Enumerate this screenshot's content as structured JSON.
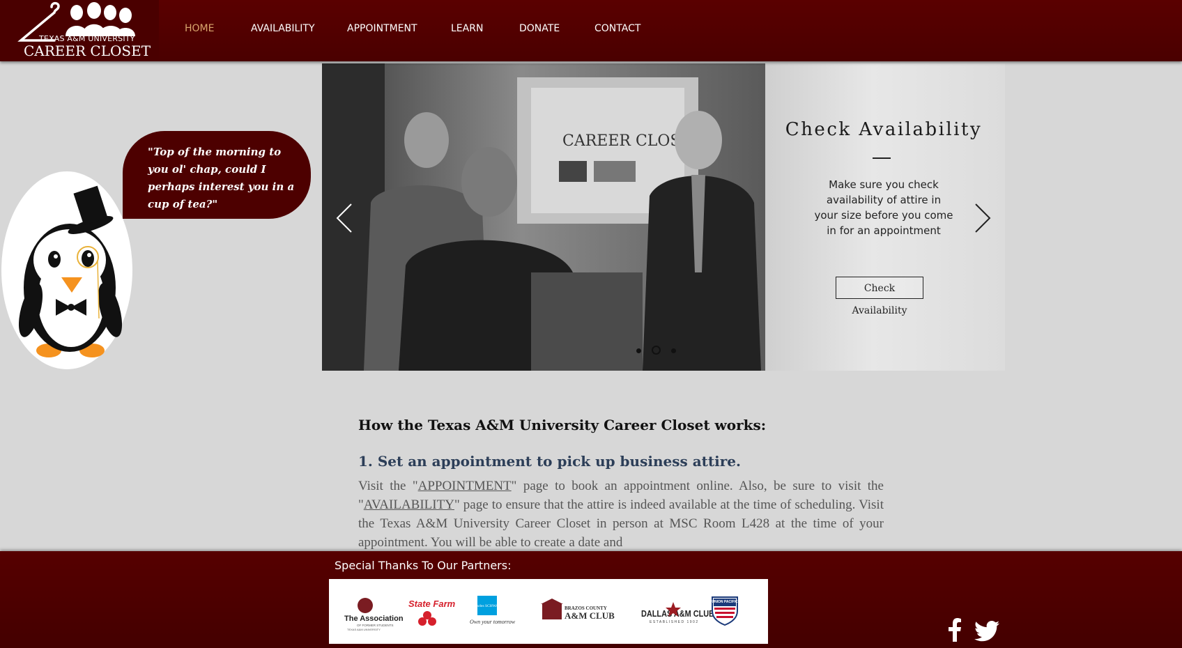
{
  "logo": {
    "top_text": "TEXAS A&M UNIVERSITY",
    "main_text": "CAREER CLOSET"
  },
  "nav": {
    "items": [
      "HOME",
      "AVAILABILITY",
      "APPOINTMENT",
      "LEARN",
      "DONATE",
      "CONTACT"
    ],
    "active": "HOME"
  },
  "bubble": {
    "quote": "\"Top of the morning to you ol' chap, could I perhaps interest you in a cup of tea?\""
  },
  "slide": {
    "title": "Check Availability",
    "description": "Make sure you check availability of attire in your size before you come in for an appointment",
    "button": "Check Availability",
    "dots": 3,
    "active_dot": 2,
    "photo_sign_text": "CAREER CLOSET"
  },
  "content": {
    "heading": "How the Texas A&M University Career Closet works:",
    "step1_heading": "1. Set an appointment to pick up business attire.",
    "p_1": "Visit the \"",
    "link_appointment": "APPOINTMENT",
    "p_2": "\" page to  book an appointment online. Also, be sure to visit the \"",
    "link_availability": "AVAILABILITY",
    "p_3": "\" page to ensure that the attire is indeed available at the time of scheduling. Visit the Texas A&M University Career Closet in person at MSC Room L428 at the time of your appointment. You will be able to create a date and"
  },
  "footer": {
    "thanks": "Special Thanks To Our Partners:",
    "partners": {
      "association_line1": "The Association",
      "association_line2": "OF FORMER STUDENTS",
      "association_line3": "TEXAS A&M UNIVERSITY",
      "statefarm": "State Farm",
      "schwab_logo": "charles SCHWAB",
      "schwab_tagline": "Own your tomorrow",
      "brazos_line1": "BRAZOS COUNTY",
      "brazos_line2": "A&M CLUB",
      "dallas_main": "DALLAS A&M CLUB",
      "dallas_sub": "ESTABLISHED 1902",
      "union_pacific": "UNION PACIFIC"
    },
    "social": [
      "facebook-icon",
      "twitter-icon"
    ]
  },
  "colors": {
    "maroon": "#500000",
    "active_nav": "#d9a66d",
    "background": "#d7d7d7"
  }
}
